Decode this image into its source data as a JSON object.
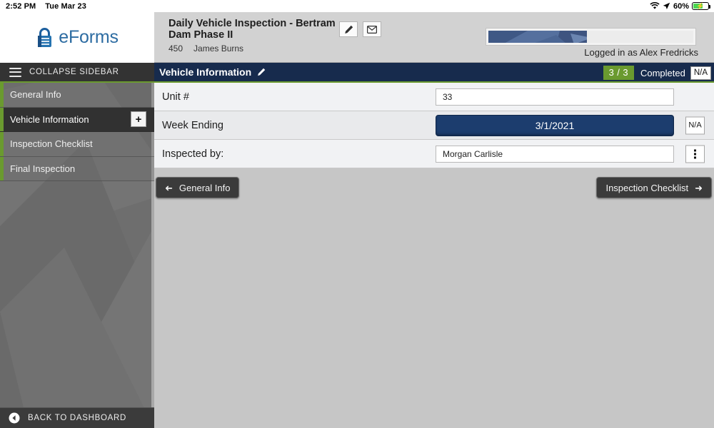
{
  "status_bar": {
    "time": "2:52 PM",
    "date": "Tue Mar 23",
    "battery_percent": "60%",
    "wifi_icon": "wifi-icon",
    "location_icon": "location-arrow-icon",
    "battery_icon": "battery-charging-icon"
  },
  "sidebar": {
    "brand": "eForms",
    "lock_icon": "lock-icon",
    "collapse_label": "COLLAPSE SIDEBAR",
    "hamburger_icon": "hamburger-icon",
    "items": [
      {
        "label": "General Info",
        "active": false,
        "has_plus": false
      },
      {
        "label": "Vehicle Information",
        "active": true,
        "has_plus": true
      },
      {
        "label": "Inspection Checklist",
        "active": false,
        "has_plus": false
      },
      {
        "label": "Final Inspection",
        "active": false,
        "has_plus": false
      }
    ],
    "plus_label": "+",
    "back_to_dashboard": "BACK TO DASHBOARD",
    "back_icon": "back-circle-arrow-icon",
    "accent_color": "#6a9a2f"
  },
  "topbar": {
    "title": "Daily Vehicle Inspection - Bertram Dam Phase II",
    "sub_number": "450",
    "sub_name": "James  Burns",
    "edit_icon": "pencil-icon",
    "mail_icon": "envelope-icon",
    "progress_percent": 48,
    "logged_in_text": "Logged in as Alex Fredricks"
  },
  "section": {
    "title": "Vehicle Information",
    "edit_icon": "pencil-icon",
    "count_badge": "3 / 3",
    "status_text": "Completed",
    "na_label": "N/A",
    "bg_color": "#172b4d",
    "badge_color": "#6a9a2f"
  },
  "form": {
    "rows": [
      {
        "label": "Unit #",
        "control": "text",
        "value": "33",
        "side_button": null
      },
      {
        "label": "Week Ending",
        "control": "date",
        "value": "3/1/2021",
        "side_button": "N/A"
      },
      {
        "label": "Inspected by:",
        "control": "text",
        "value": "Morgan Carlisle",
        "side_button": "dots"
      }
    ]
  },
  "footer_nav": {
    "prev_label": "General Info",
    "next_label": "Inspection Checklist",
    "prev_icon": "arrow-left-icon",
    "next_icon": "arrow-right-icon"
  }
}
